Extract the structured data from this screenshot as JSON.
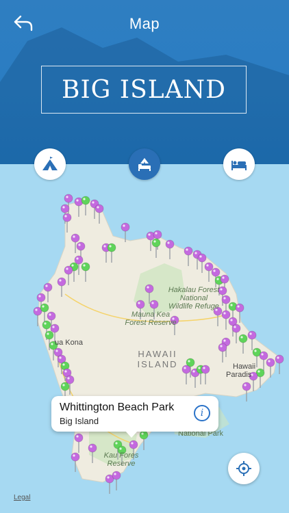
{
  "header": {
    "title": "Map",
    "banner": "BIG ISLAND"
  },
  "categories": [
    {
      "name": "camping",
      "icon": "tent-icon",
      "active": false
    },
    {
      "name": "camping-lodging",
      "icon": "tent-bed-icon",
      "active": true
    },
    {
      "name": "lodging",
      "icon": "bed-icon",
      "active": false
    }
  ],
  "map": {
    "labels": {
      "forest_refuge": "Hakalau Forest\nNational\nWildlife Refuge",
      "mauna_kea": "Mauna Kea\nForest Reserve",
      "kona": "ua Kona",
      "island": "HAWAII\nISLAND",
      "hawaii": "Hawaii",
      "paradise": "Paradis",
      "national_park": "National Park",
      "kau": "Kau Fores\nReserve"
    }
  },
  "callout": {
    "title": "Whittington Beach Park",
    "subtitle": "Big Island"
  },
  "legal": "Legal",
  "colors": {
    "header": "#2b7dc2",
    "ocean": "#a6d9f2",
    "pin_purple": "#c46adf",
    "pin_green": "#5fd45a"
  }
}
